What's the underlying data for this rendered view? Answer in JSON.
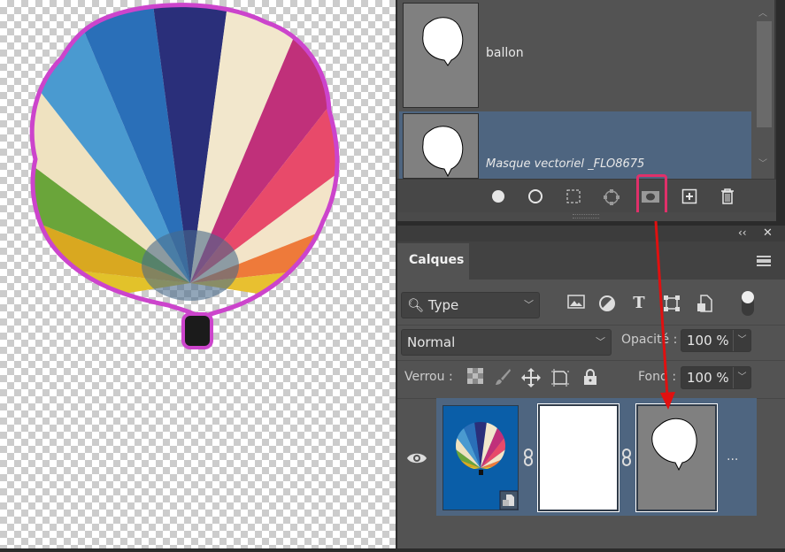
{
  "canvas": {
    "balloon_colors": [
      "#e2c22a",
      "#d9a820",
      "#6aa53a",
      "#efe2c0",
      "#4a9ad0",
      "#2a6fb8",
      "#2a2f7a",
      "#f2e7cc",
      "#c0307a",
      "#e84a6a",
      "#f3e4c8",
      "#ee7a3a",
      "#e8c030"
    ],
    "outline_color": "#cc44cc"
  },
  "paths_panel": {
    "rows": [
      {
        "name": "ballon",
        "selected": false
      },
      {
        "name": "Masque vectoriel _FLO8675",
        "selected": true
      }
    ],
    "toolbar": [
      "fill-path-icon",
      "stroke-path-icon",
      "load-selection-icon",
      "make-path-icon",
      "add-mask-icon",
      "new-path-icon",
      "trash-icon"
    ],
    "highlight_color": "#e0306a"
  },
  "layers_panel": {
    "collapse": "‹‹",
    "close": "✕",
    "tab": "Calques",
    "filter": {
      "value": "Type"
    },
    "blend": {
      "value": "Normal"
    },
    "opacity": {
      "label": "Opacité :",
      "value": "100 %"
    },
    "lock": {
      "label": "Verrou :"
    },
    "fill": {
      "label": "Fond :",
      "value": "100 %"
    },
    "layer": {
      "more": "..."
    }
  },
  "annotation": {
    "arrow_color": "#e01010"
  }
}
